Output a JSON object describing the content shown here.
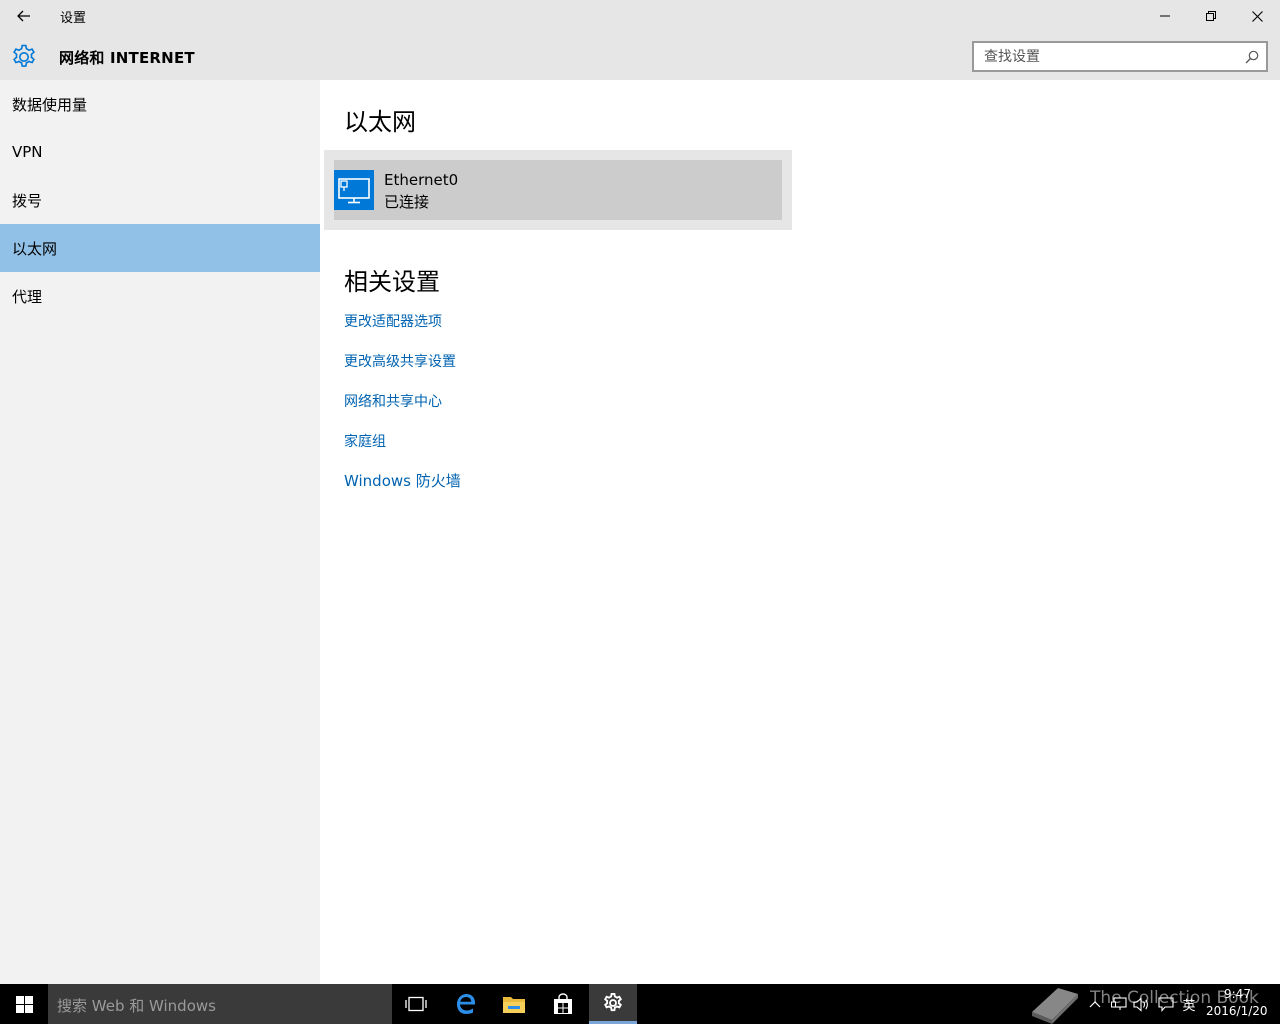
{
  "window": {
    "title": "设置",
    "minimize_icon": "minimize-icon",
    "maximize_icon": "restore-icon",
    "close_icon": "close-icon"
  },
  "header": {
    "title": "网络和 INTERNET",
    "icon": "gear-icon",
    "search": {
      "placeholder": "查找设置",
      "value": ""
    }
  },
  "sidebar": {
    "items": [
      {
        "label": "数据使用量",
        "selected": false
      },
      {
        "label": "VPN",
        "selected": false
      },
      {
        "label": "拨号",
        "selected": false
      },
      {
        "label": "以太网",
        "selected": true
      },
      {
        "label": "代理",
        "selected": false
      }
    ]
  },
  "main": {
    "ethernet_heading": "以太网",
    "adapter": {
      "name": "Ethernet0",
      "status": "已连接",
      "icon": "ethernet-monitor-icon"
    },
    "related_heading": "相关设置",
    "links": [
      "更改适配器选项",
      "更改高级共享设置",
      "网络和共享中心",
      "家庭组",
      "Windows 防火墙"
    ]
  },
  "taskbar": {
    "search_placeholder": "搜索 Web 和 Windows",
    "apps": [
      "task-view-icon",
      "edge-icon",
      "file-explorer-icon",
      "store-icon",
      "settings-icon"
    ],
    "active_app": "settings-icon",
    "tray": {
      "ime": "英",
      "time": "9:47",
      "date": "2016/1/20"
    },
    "watermark": "The Collection Book"
  },
  "colors": {
    "accent": "#0078d7",
    "selected_bg": "#91c1e6",
    "link": "#0063b1",
    "sidebar_bg": "#f2f2f2",
    "titlebar_bg": "#e6e6e6",
    "taskbar_bg": "#000000"
  }
}
